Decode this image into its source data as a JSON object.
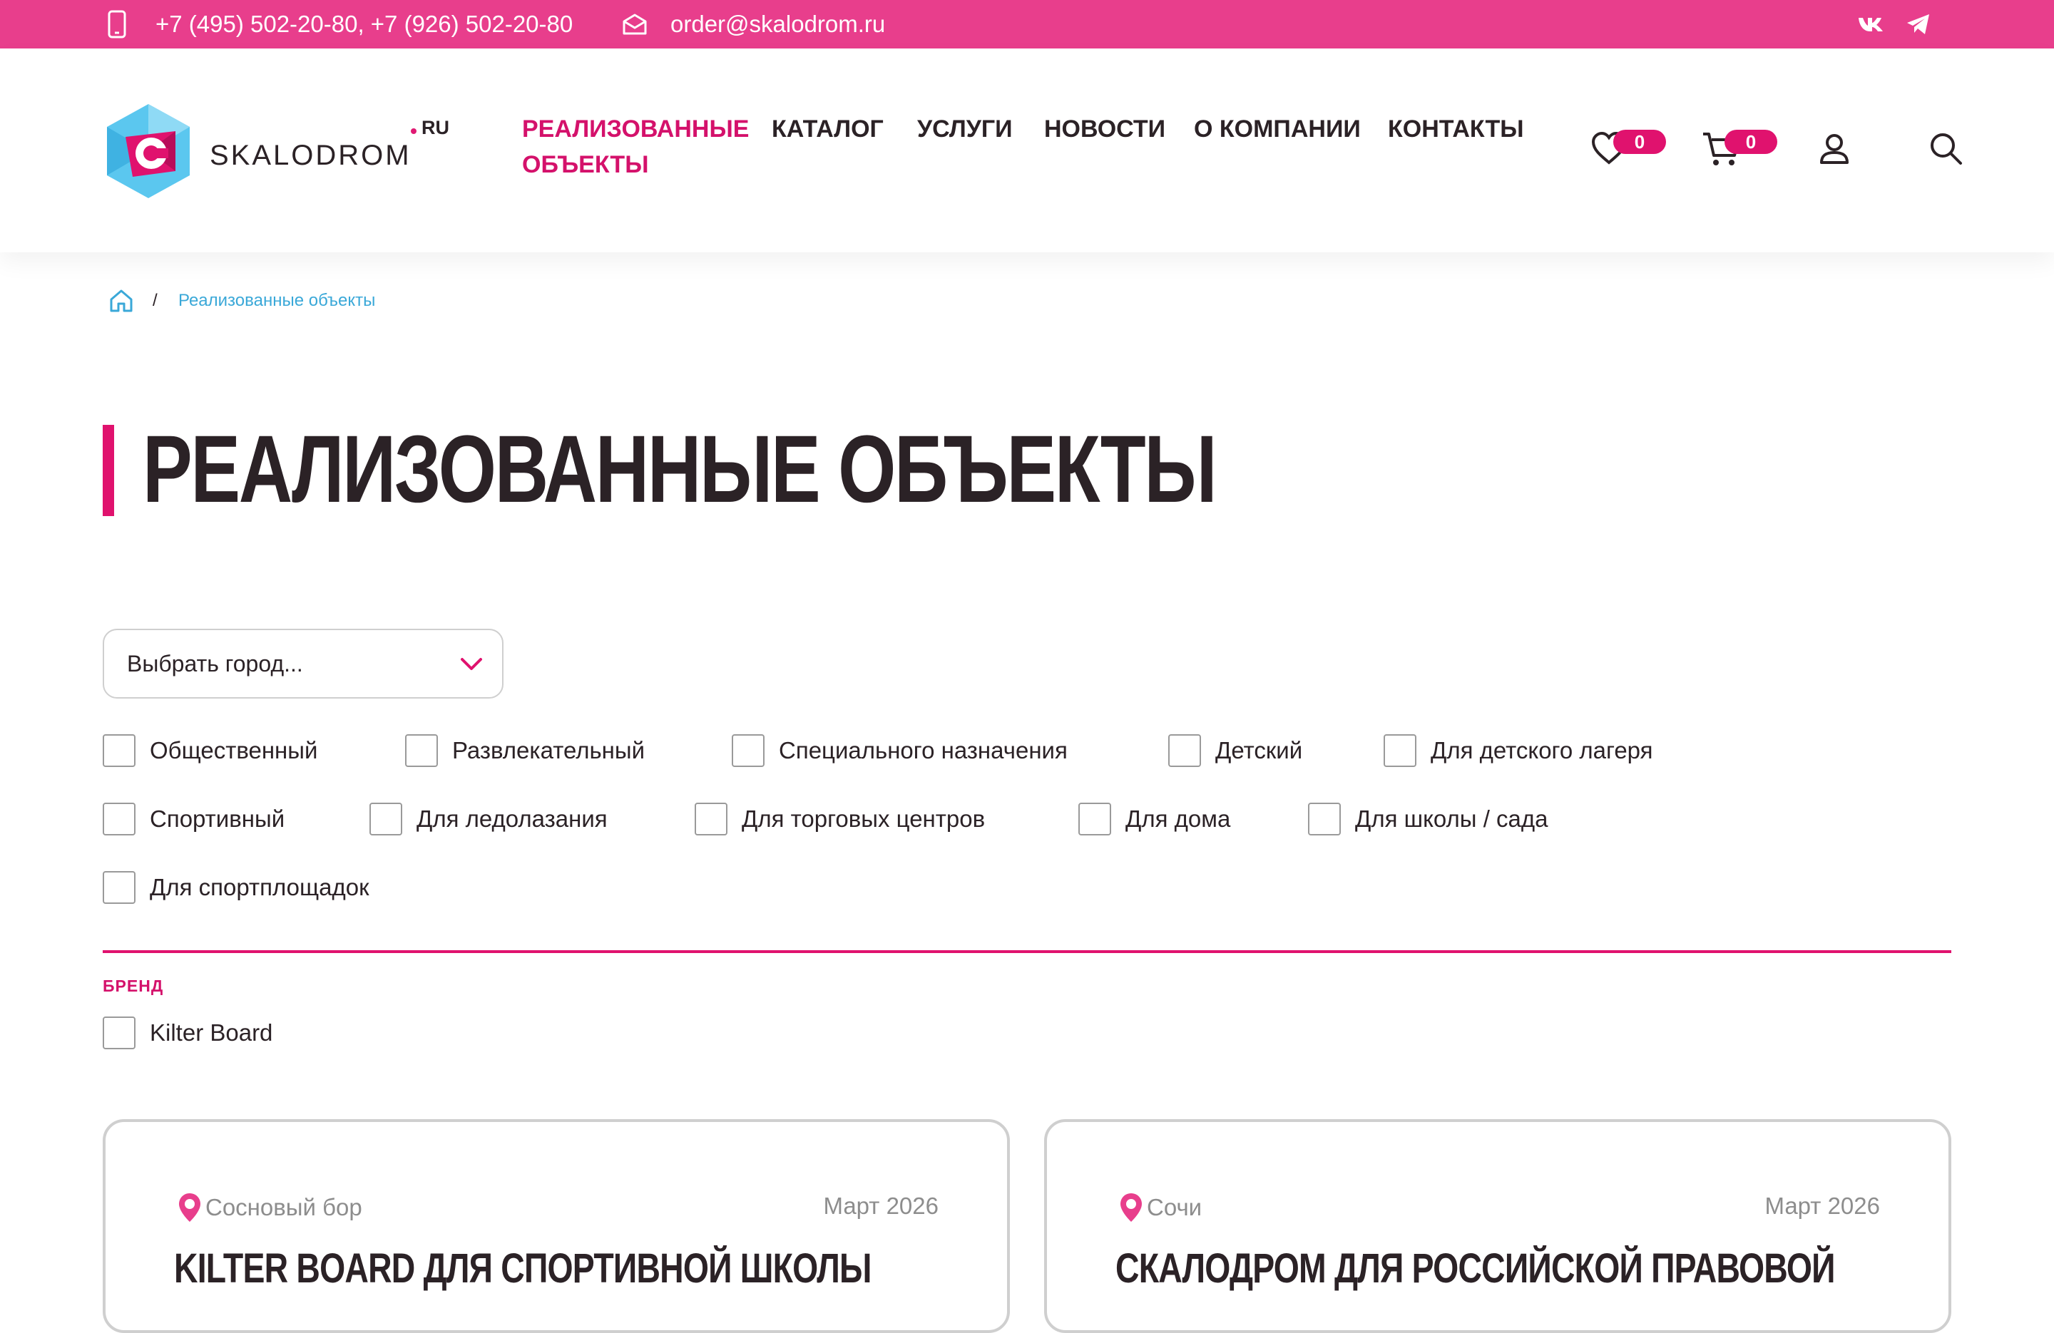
{
  "topbar": {
    "phones": "+7 (495) 502-20-80, +7 (926) 502-20-80",
    "email": "order@skalodrom.ru",
    "icons": [
      "phone-icon",
      "mail-icon",
      "vk-icon",
      "telegram-icon"
    ]
  },
  "logo": {
    "text": "SKALODROM",
    "suffix": "RU",
    "letter": "C"
  },
  "nav": {
    "items": [
      "РЕАЛИЗОВАННЫЕ ОБЪЕКТЫ",
      "КАТАЛОГ",
      "УСЛУГИ",
      "НОВОСТИ",
      "О КОМПАНИИ",
      "КОНТАКТЫ"
    ]
  },
  "header_icons": {
    "favorites_count": "0",
    "cart_count": "0"
  },
  "breadcrumb": {
    "separator": "/",
    "current": "Реализованные объекты"
  },
  "page_title": "РЕАЛИЗОВАННЫЕ ОБЪЕКТЫ",
  "filters": {
    "city_placeholder": "Выбрать город...",
    "types": [
      "Общественный",
      "Развлекательный",
      "Специального назначения",
      "Детский",
      "Для детского лагеря",
      "Спортивный",
      "Для ледолазания",
      "Для торговых центров",
      "Для дома",
      "Для школы / сада",
      "Для спортплощадок"
    ],
    "brand_title": "БРЕНД",
    "brands": [
      "Kilter Board"
    ]
  },
  "cards": [
    {
      "location": "Сосновый бор",
      "date": "Март 2026",
      "title": "KILTER BOARD ДЛЯ СПОРТИВНОЙ ШКОЛЫ"
    },
    {
      "location": "Сочи",
      "date": "Март 2026",
      "title": "СКАЛОДРОМ ДЛЯ РОССИЙСКОЙ ПРАВОВОЙ"
    }
  ],
  "colors": {
    "accent": "#e83e8c",
    "accent_dark": "#d4116b",
    "text": "#2b2226",
    "link": "#3aa8d8"
  }
}
